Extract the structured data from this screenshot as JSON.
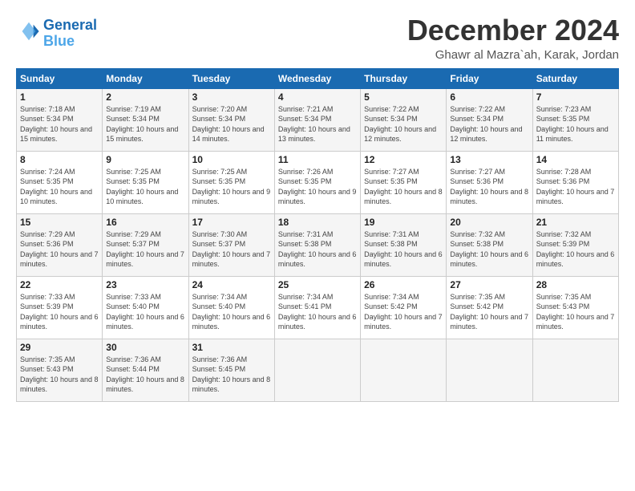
{
  "logo": {
    "line1": "General",
    "line2": "Blue"
  },
  "title": "December 2024",
  "subtitle": "Ghawr al Mazra`ah, Karak, Jordan",
  "days_of_week": [
    "Sunday",
    "Monday",
    "Tuesday",
    "Wednesday",
    "Thursday",
    "Friday",
    "Saturday"
  ],
  "weeks": [
    [
      {
        "day": "1",
        "sunrise": "7:18 AM",
        "sunset": "5:34 PM",
        "daylight": "10 hours and 15 minutes."
      },
      {
        "day": "2",
        "sunrise": "7:19 AM",
        "sunset": "5:34 PM",
        "daylight": "10 hours and 15 minutes."
      },
      {
        "day": "3",
        "sunrise": "7:20 AM",
        "sunset": "5:34 PM",
        "daylight": "10 hours and 14 minutes."
      },
      {
        "day": "4",
        "sunrise": "7:21 AM",
        "sunset": "5:34 PM",
        "daylight": "10 hours and 13 minutes."
      },
      {
        "day": "5",
        "sunrise": "7:22 AM",
        "sunset": "5:34 PM",
        "daylight": "10 hours and 12 minutes."
      },
      {
        "day": "6",
        "sunrise": "7:22 AM",
        "sunset": "5:34 PM",
        "daylight": "10 hours and 12 minutes."
      },
      {
        "day": "7",
        "sunrise": "7:23 AM",
        "sunset": "5:35 PM",
        "daylight": "10 hours and 11 minutes."
      }
    ],
    [
      {
        "day": "8",
        "sunrise": "7:24 AM",
        "sunset": "5:35 PM",
        "daylight": "10 hours and 10 minutes."
      },
      {
        "day": "9",
        "sunrise": "7:25 AM",
        "sunset": "5:35 PM",
        "daylight": "10 hours and 10 minutes."
      },
      {
        "day": "10",
        "sunrise": "7:25 AM",
        "sunset": "5:35 PM",
        "daylight": "10 hours and 9 minutes."
      },
      {
        "day": "11",
        "sunrise": "7:26 AM",
        "sunset": "5:35 PM",
        "daylight": "10 hours and 9 minutes."
      },
      {
        "day": "12",
        "sunrise": "7:27 AM",
        "sunset": "5:35 PM",
        "daylight": "10 hours and 8 minutes."
      },
      {
        "day": "13",
        "sunrise": "7:27 AM",
        "sunset": "5:36 PM",
        "daylight": "10 hours and 8 minutes."
      },
      {
        "day": "14",
        "sunrise": "7:28 AM",
        "sunset": "5:36 PM",
        "daylight": "10 hours and 7 minutes."
      }
    ],
    [
      {
        "day": "15",
        "sunrise": "7:29 AM",
        "sunset": "5:36 PM",
        "daylight": "10 hours and 7 minutes."
      },
      {
        "day": "16",
        "sunrise": "7:29 AM",
        "sunset": "5:37 PM",
        "daylight": "10 hours and 7 minutes."
      },
      {
        "day": "17",
        "sunrise": "7:30 AM",
        "sunset": "5:37 PM",
        "daylight": "10 hours and 7 minutes."
      },
      {
        "day": "18",
        "sunrise": "7:31 AM",
        "sunset": "5:38 PM",
        "daylight": "10 hours and 6 minutes."
      },
      {
        "day": "19",
        "sunrise": "7:31 AM",
        "sunset": "5:38 PM",
        "daylight": "10 hours and 6 minutes."
      },
      {
        "day": "20",
        "sunrise": "7:32 AM",
        "sunset": "5:38 PM",
        "daylight": "10 hours and 6 minutes."
      },
      {
        "day": "21",
        "sunrise": "7:32 AM",
        "sunset": "5:39 PM",
        "daylight": "10 hours and 6 minutes."
      }
    ],
    [
      {
        "day": "22",
        "sunrise": "7:33 AM",
        "sunset": "5:39 PM",
        "daylight": "10 hours and 6 minutes."
      },
      {
        "day": "23",
        "sunrise": "7:33 AM",
        "sunset": "5:40 PM",
        "daylight": "10 hours and 6 minutes."
      },
      {
        "day": "24",
        "sunrise": "7:34 AM",
        "sunset": "5:40 PM",
        "daylight": "10 hours and 6 minutes."
      },
      {
        "day": "25",
        "sunrise": "7:34 AM",
        "sunset": "5:41 PM",
        "daylight": "10 hours and 6 minutes."
      },
      {
        "day": "26",
        "sunrise": "7:34 AM",
        "sunset": "5:42 PM",
        "daylight": "10 hours and 7 minutes."
      },
      {
        "day": "27",
        "sunrise": "7:35 AM",
        "sunset": "5:42 PM",
        "daylight": "10 hours and 7 minutes."
      },
      {
        "day": "28",
        "sunrise": "7:35 AM",
        "sunset": "5:43 PM",
        "daylight": "10 hours and 7 minutes."
      }
    ],
    [
      {
        "day": "29",
        "sunrise": "7:35 AM",
        "sunset": "5:43 PM",
        "daylight": "10 hours and 8 minutes."
      },
      {
        "day": "30",
        "sunrise": "7:36 AM",
        "sunset": "5:44 PM",
        "daylight": "10 hours and 8 minutes."
      },
      {
        "day": "31",
        "sunrise": "7:36 AM",
        "sunset": "5:45 PM",
        "daylight": "10 hours and 8 minutes."
      },
      null,
      null,
      null,
      null
    ]
  ]
}
